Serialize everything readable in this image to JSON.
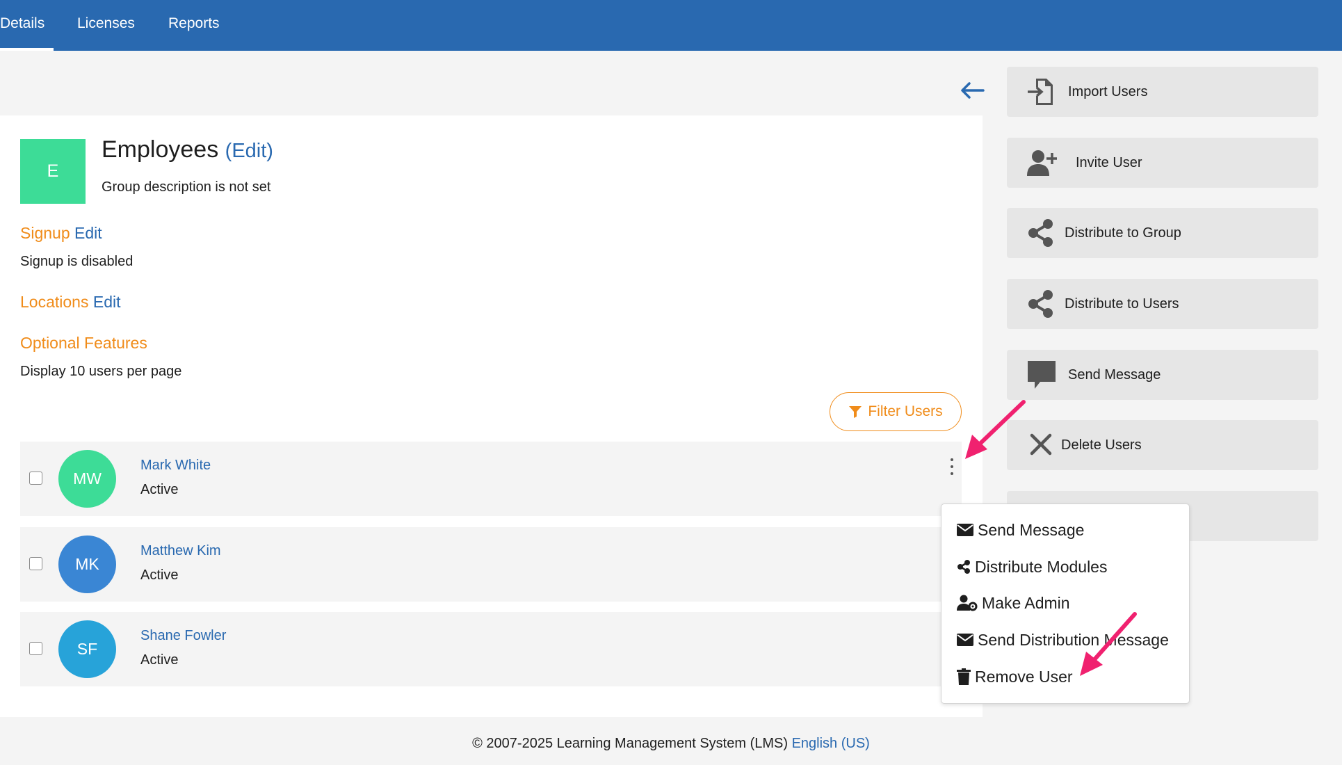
{
  "tabs": [
    {
      "label": "Details",
      "active": true
    },
    {
      "label": "Licenses",
      "active": false
    },
    {
      "label": "Reports",
      "active": false
    }
  ],
  "group": {
    "initial": "E",
    "name": "Employees",
    "edit_label": "(Edit)",
    "description": "Group description is not set"
  },
  "signup": {
    "title": "Signup",
    "edit": "Edit",
    "text": "Signup is disabled"
  },
  "locations": {
    "title": "Locations",
    "edit": "Edit"
  },
  "optional": {
    "title": "Optional Features",
    "text": "Display 10 users per page"
  },
  "filter_label": "Filter Users",
  "users": [
    {
      "initials": "MW",
      "name": "Mark White",
      "status": "Active",
      "color": "#3ddc97"
    },
    {
      "initials": "MK",
      "name": "Matthew Kim",
      "status": "Active",
      "color": "#3a86d4"
    },
    {
      "initials": "SF",
      "name": "Shane Fowler",
      "status": "Active",
      "color": "#27a3d9"
    }
  ],
  "actions": [
    {
      "label": "Import Users",
      "icon": "import-file-icon"
    },
    {
      "label": "Invite User",
      "icon": "user-plus-icon"
    },
    {
      "label": "Distribute to Group",
      "icon": "share-icon"
    },
    {
      "label": "Distribute to Users",
      "icon": "share-icon"
    },
    {
      "label": "Send Message",
      "icon": "comment-icon"
    },
    {
      "label": "Delete Users",
      "icon": "close-icon"
    }
  ],
  "menu": [
    {
      "label": "Send Message",
      "icon": "envelope-icon"
    },
    {
      "label": "Distribute Modules",
      "icon": "share-icon"
    },
    {
      "label": "Make Admin",
      "icon": "user-gear-icon"
    },
    {
      "label": "Send Distribution Message",
      "icon": "envelope-icon"
    },
    {
      "label": "Remove User",
      "icon": "trash-icon"
    }
  ],
  "footer": {
    "copyright": "© 2007-2025 Learning Management System (LMS)",
    "language": "English (US)"
  },
  "colors": {
    "nav": "#2969b0",
    "accent": "#f08c1a",
    "link": "#2969b0",
    "annotation": "#f0216f"
  }
}
